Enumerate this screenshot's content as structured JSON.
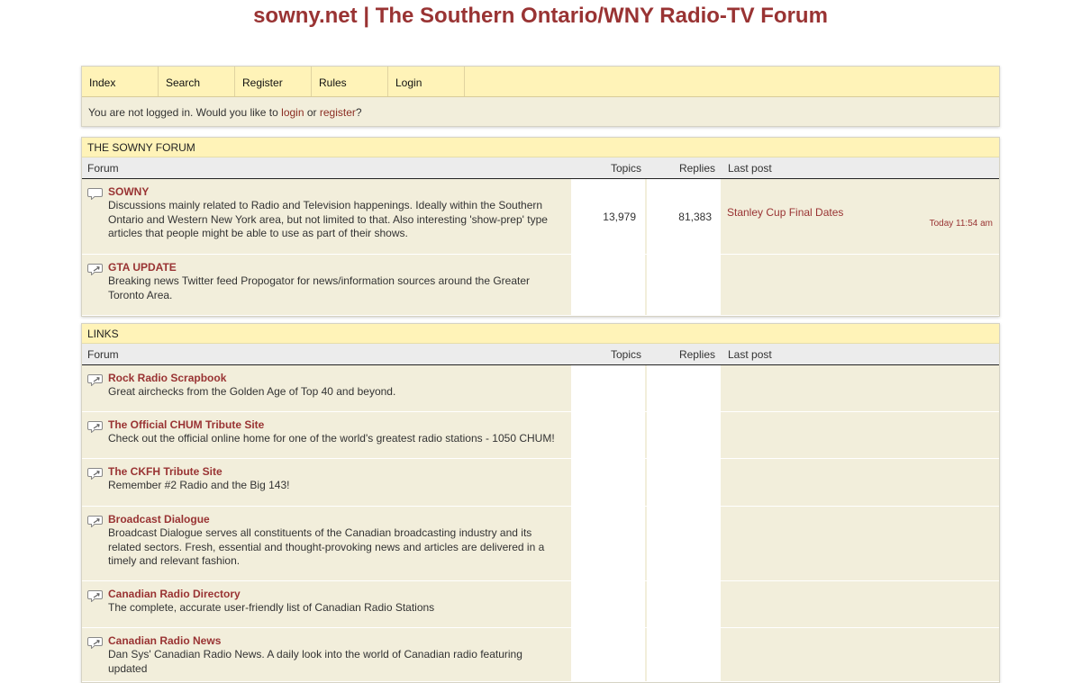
{
  "site": {
    "title": "sowny.net | The Southern Ontario/WNY Radio-TV Forum"
  },
  "nav": {
    "tabs": [
      "Index",
      "Search",
      "Register",
      "Rules",
      "Login"
    ],
    "login_msg_prefix": "You are not logged in. Would you like to ",
    "login_link": "login",
    "login_msg_or": " or ",
    "register_link": "register",
    "login_msg_suffix": "?"
  },
  "columns": {
    "forum": "Forum",
    "topics": "Topics",
    "replies": "Replies",
    "last_post": "Last post"
  },
  "sowny_section": {
    "title": "THE SOWNY FORUM",
    "forums": [
      {
        "name": "SOWNY",
        "description": "Discussions mainly related to Radio and Television happenings. Ideally within the Southern Ontario and Western New York area, but not limited to that. Also interesting 'show-prep' type articles that people might be able to use as part of their shows.",
        "topics": "13,979",
        "replies": "81,383",
        "last_post_title": "Stanley Cup Final Dates",
        "last_post_time": "Today 11:54 am",
        "icon": "speech-bubble-icon"
      },
      {
        "name": "GTA UPDATE",
        "description": "Breaking news Twitter feed Propogator for news/information sources around the Greater Toronto Area.",
        "icon": "redirect-icon"
      }
    ]
  },
  "links_section": {
    "title": "LINKS",
    "forums": [
      {
        "name": "Rock Radio Scrapbook",
        "description": "Great airchecks from the Golden Age of Top 40 and beyond.",
        "icon": "redirect-icon"
      },
      {
        "name": "The Official CHUM Tribute Site",
        "description": "Check out the official online home for one of the world's greatest radio stations - 1050 CHUM!",
        "icon": "redirect-icon"
      },
      {
        "name": "The CKFH Tribute Site",
        "description": "Remember #2 Radio and the Big 143!",
        "icon": "redirect-icon"
      },
      {
        "name": "Broadcast Dialogue",
        "description": "Broadcast Dialogue serves all constituents of the Canadian broadcasting industry and its related sectors. Fresh, essential and thought-provoking news and articles are delivered in a timely and relevant fashion.",
        "icon": "redirect-icon"
      },
      {
        "name": "Canadian Radio Directory",
        "description": "The complete, accurate user-friendly list of Canadian Radio Stations",
        "icon": "redirect-icon"
      },
      {
        "name": "Canadian Radio News",
        "description": "Dan Sys' Canadian Radio News. A daily look into the world of Canadian radio featuring updated",
        "icon": "redirect-icon"
      }
    ]
  },
  "colors": {
    "accent": "#993333",
    "header_bg": "#fff3b8",
    "row_bg": "#f2eedb"
  }
}
